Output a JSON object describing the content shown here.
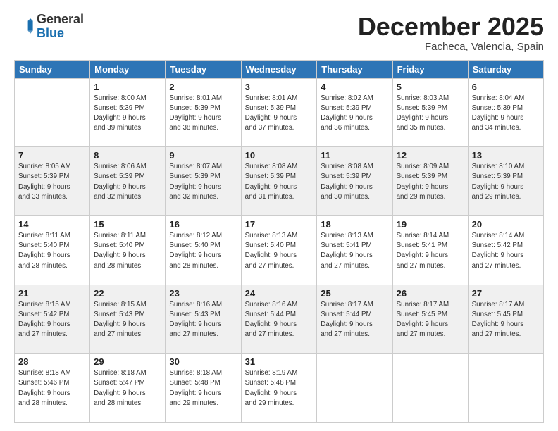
{
  "header": {
    "logo_general": "General",
    "logo_blue": "Blue",
    "title": "December 2025",
    "subtitle": "Facheca, Valencia, Spain"
  },
  "calendar": {
    "days_of_week": [
      "Sunday",
      "Monday",
      "Tuesday",
      "Wednesday",
      "Thursday",
      "Friday",
      "Saturday"
    ],
    "weeks": [
      [
        {
          "day": "",
          "info": ""
        },
        {
          "day": "1",
          "info": "Sunrise: 8:00 AM\nSunset: 5:39 PM\nDaylight: 9 hours\nand 39 minutes."
        },
        {
          "day": "2",
          "info": "Sunrise: 8:01 AM\nSunset: 5:39 PM\nDaylight: 9 hours\nand 38 minutes."
        },
        {
          "day": "3",
          "info": "Sunrise: 8:01 AM\nSunset: 5:39 PM\nDaylight: 9 hours\nand 37 minutes."
        },
        {
          "day": "4",
          "info": "Sunrise: 8:02 AM\nSunset: 5:39 PM\nDaylight: 9 hours\nand 36 minutes."
        },
        {
          "day": "5",
          "info": "Sunrise: 8:03 AM\nSunset: 5:39 PM\nDaylight: 9 hours\nand 35 minutes."
        },
        {
          "day": "6",
          "info": "Sunrise: 8:04 AM\nSunset: 5:39 PM\nDaylight: 9 hours\nand 34 minutes."
        }
      ],
      [
        {
          "day": "7",
          "info": "Sunrise: 8:05 AM\nSunset: 5:39 PM\nDaylight: 9 hours\nand 33 minutes."
        },
        {
          "day": "8",
          "info": "Sunrise: 8:06 AM\nSunset: 5:39 PM\nDaylight: 9 hours\nand 32 minutes."
        },
        {
          "day": "9",
          "info": "Sunrise: 8:07 AM\nSunset: 5:39 PM\nDaylight: 9 hours\nand 32 minutes."
        },
        {
          "day": "10",
          "info": "Sunrise: 8:08 AM\nSunset: 5:39 PM\nDaylight: 9 hours\nand 31 minutes."
        },
        {
          "day": "11",
          "info": "Sunrise: 8:08 AM\nSunset: 5:39 PM\nDaylight: 9 hours\nand 30 minutes."
        },
        {
          "day": "12",
          "info": "Sunrise: 8:09 AM\nSunset: 5:39 PM\nDaylight: 9 hours\nand 29 minutes."
        },
        {
          "day": "13",
          "info": "Sunrise: 8:10 AM\nSunset: 5:39 PM\nDaylight: 9 hours\nand 29 minutes."
        }
      ],
      [
        {
          "day": "14",
          "info": "Sunrise: 8:11 AM\nSunset: 5:40 PM\nDaylight: 9 hours\nand 28 minutes."
        },
        {
          "day": "15",
          "info": "Sunrise: 8:11 AM\nSunset: 5:40 PM\nDaylight: 9 hours\nand 28 minutes."
        },
        {
          "day": "16",
          "info": "Sunrise: 8:12 AM\nSunset: 5:40 PM\nDaylight: 9 hours\nand 28 minutes."
        },
        {
          "day": "17",
          "info": "Sunrise: 8:13 AM\nSunset: 5:40 PM\nDaylight: 9 hours\nand 27 minutes."
        },
        {
          "day": "18",
          "info": "Sunrise: 8:13 AM\nSunset: 5:41 PM\nDaylight: 9 hours\nand 27 minutes."
        },
        {
          "day": "19",
          "info": "Sunrise: 8:14 AM\nSunset: 5:41 PM\nDaylight: 9 hours\nand 27 minutes."
        },
        {
          "day": "20",
          "info": "Sunrise: 8:14 AM\nSunset: 5:42 PM\nDaylight: 9 hours\nand 27 minutes."
        }
      ],
      [
        {
          "day": "21",
          "info": "Sunrise: 8:15 AM\nSunset: 5:42 PM\nDaylight: 9 hours\nand 27 minutes."
        },
        {
          "day": "22",
          "info": "Sunrise: 8:15 AM\nSunset: 5:43 PM\nDaylight: 9 hours\nand 27 minutes."
        },
        {
          "day": "23",
          "info": "Sunrise: 8:16 AM\nSunset: 5:43 PM\nDaylight: 9 hours\nand 27 minutes."
        },
        {
          "day": "24",
          "info": "Sunrise: 8:16 AM\nSunset: 5:44 PM\nDaylight: 9 hours\nand 27 minutes."
        },
        {
          "day": "25",
          "info": "Sunrise: 8:17 AM\nSunset: 5:44 PM\nDaylight: 9 hours\nand 27 minutes."
        },
        {
          "day": "26",
          "info": "Sunrise: 8:17 AM\nSunset: 5:45 PM\nDaylight: 9 hours\nand 27 minutes."
        },
        {
          "day": "27",
          "info": "Sunrise: 8:17 AM\nSunset: 5:45 PM\nDaylight: 9 hours\nand 27 minutes."
        }
      ],
      [
        {
          "day": "28",
          "info": "Sunrise: 8:18 AM\nSunset: 5:46 PM\nDaylight: 9 hours\nand 28 minutes."
        },
        {
          "day": "29",
          "info": "Sunrise: 8:18 AM\nSunset: 5:47 PM\nDaylight: 9 hours\nand 28 minutes."
        },
        {
          "day": "30",
          "info": "Sunrise: 8:18 AM\nSunset: 5:48 PM\nDaylight: 9 hours\nand 29 minutes."
        },
        {
          "day": "31",
          "info": "Sunrise: 8:19 AM\nSunset: 5:48 PM\nDaylight: 9 hours\nand 29 minutes."
        },
        {
          "day": "",
          "info": ""
        },
        {
          "day": "",
          "info": ""
        },
        {
          "day": "",
          "info": ""
        }
      ]
    ]
  }
}
